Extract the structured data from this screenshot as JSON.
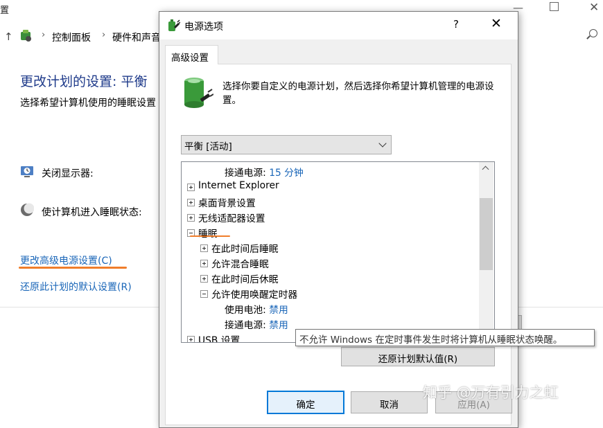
{
  "background_window": {
    "title_fragment": "置",
    "breadcrumb": [
      "控制面板",
      "硬件和声音"
    ],
    "heading": "更改计划的设置: 平衡",
    "subheading": "选择希望计算机使用的睡眠设置",
    "rows": [
      {
        "label": "关闭显示器:",
        "icon": "monitor-icon"
      },
      {
        "label": "使计算机进入睡眠状态:",
        "icon": "moon-icon"
      }
    ],
    "links": {
      "advanced": "更改高级电源设置(C)",
      "restore": "还原此计划的默认设置(R)"
    }
  },
  "dialog": {
    "title": "电源选项",
    "help": "?",
    "close": "✕",
    "tab": "高级设置",
    "description": "选择你要自定义的电源计划，然后选择你希望计算机管理的电源设置。",
    "plan_select": "平衡 [活动]",
    "tree": [
      {
        "label": "接通电源: ",
        "value": "15 分钟",
        "level": 2
      },
      {
        "label": "Internet Explorer",
        "level": 0,
        "expander": "plus"
      },
      {
        "label": "桌面背景设置",
        "level": 0,
        "expander": "plus"
      },
      {
        "label": "无线适配器设置",
        "level": 0,
        "expander": "plus"
      },
      {
        "label": "睡眠",
        "level": 0,
        "expander": "minus"
      },
      {
        "label": "在此时间后睡眠",
        "level": 1,
        "expander": "plus"
      },
      {
        "label": "允许混合睡眠",
        "level": 1,
        "expander": "plus"
      },
      {
        "label": "在此时间后休眠",
        "level": 1,
        "expander": "plus"
      },
      {
        "label": "允许使用唤醒定时器",
        "level": 1,
        "expander": "minus"
      },
      {
        "label": "使用电池: ",
        "value": "禁用",
        "level": 2
      },
      {
        "label": "接通电源: ",
        "value": "禁用",
        "level": 2
      },
      {
        "label": "USB 设置",
        "level": 0,
        "expander": "plus"
      }
    ],
    "restore_button": "还原计划默认值(R)",
    "buttons": {
      "ok": "确定",
      "cancel": "取消",
      "apply": "应用(A)"
    }
  },
  "tooltip": "不允许 Windows 在定时事件发生时将计算机从睡眠状态唤醒。",
  "watermark": "知乎 @万有引力之虹",
  "colors": {
    "link": "#1a66b8",
    "annotation": "#f07d2a",
    "focus": "#0078d7"
  }
}
